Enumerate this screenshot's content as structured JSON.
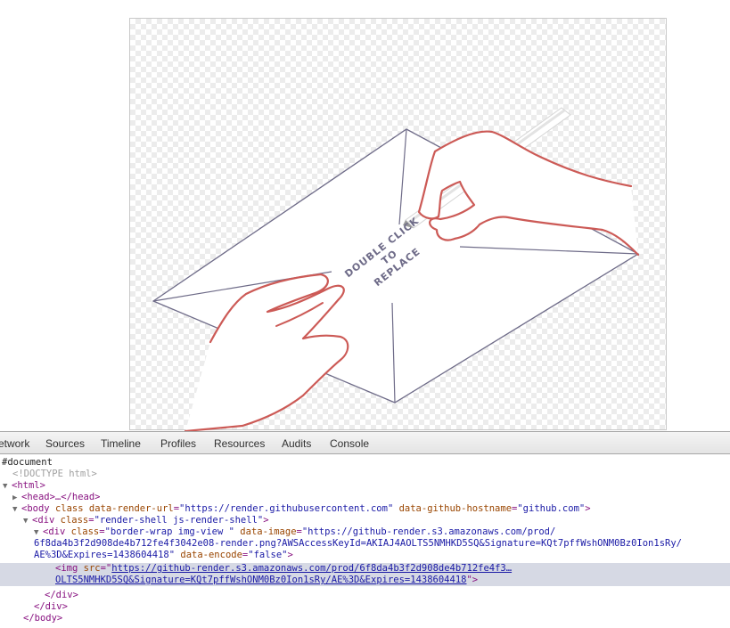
{
  "canvas": {
    "text_line1": "DOUBLE CLICK",
    "text_line2": "TO",
    "text_line3": "REPLACE"
  },
  "devtools": {
    "tabs": [
      "etwork",
      "Sources",
      "Timeline",
      "Profiles",
      "Resources",
      "Audits",
      "Console"
    ],
    "tree": {
      "document": "#document",
      "doctype": "<!DOCTYPE html>",
      "html_open": "<html>",
      "head_collapsed": "<head>…</head>",
      "body_tag": "body",
      "body_attr1": "class",
      "body_attr2": "data-render-url",
      "body_val2": "\"https://render.githubusercontent.com\"",
      "body_attr3": "data-github-hostname",
      "body_val3": "\"github.com\"",
      "shell_tag": "div",
      "shell_attr": "class",
      "shell_val": "\"render-shell js-render-shell\"",
      "wrap_tag": "div",
      "wrap_attr1": "class",
      "wrap_val1": "\"border-wrap img-view \"",
      "wrap_attr2": "data-image",
      "wrap_val2_line1": "\"https://github-render.s3.amazonaws.com/prod/",
      "wrap_val2_line2": "6f8da4b3f2d908de4b712fe4f3042e08-render.png?AWSAccessKeyId=AKIAJ4AOLTS5NMHKD5SQ&Signature=KQt7pffWshONM0Bz0Ion1sRy/",
      "wrap_val2_line3": "AE%3D&Expires=1438604418\"",
      "wrap_attr3": "data-encode",
      "wrap_val3": "\"false\"",
      "img_tag": "img",
      "img_attr": "src",
      "img_val_line1": "https://github-render.s3.amazonaws.com/prod/6f8da4b3f2d908de4b712fe4f3…",
      "img_val_line2": "OLTS5NMHKD5SQ&Signature=KQt7pffWshONM0Bz0Ion1sRy/AE%3D&Expires=1438604418",
      "div_close": "</div>",
      "body_close": "</body>"
    }
  }
}
